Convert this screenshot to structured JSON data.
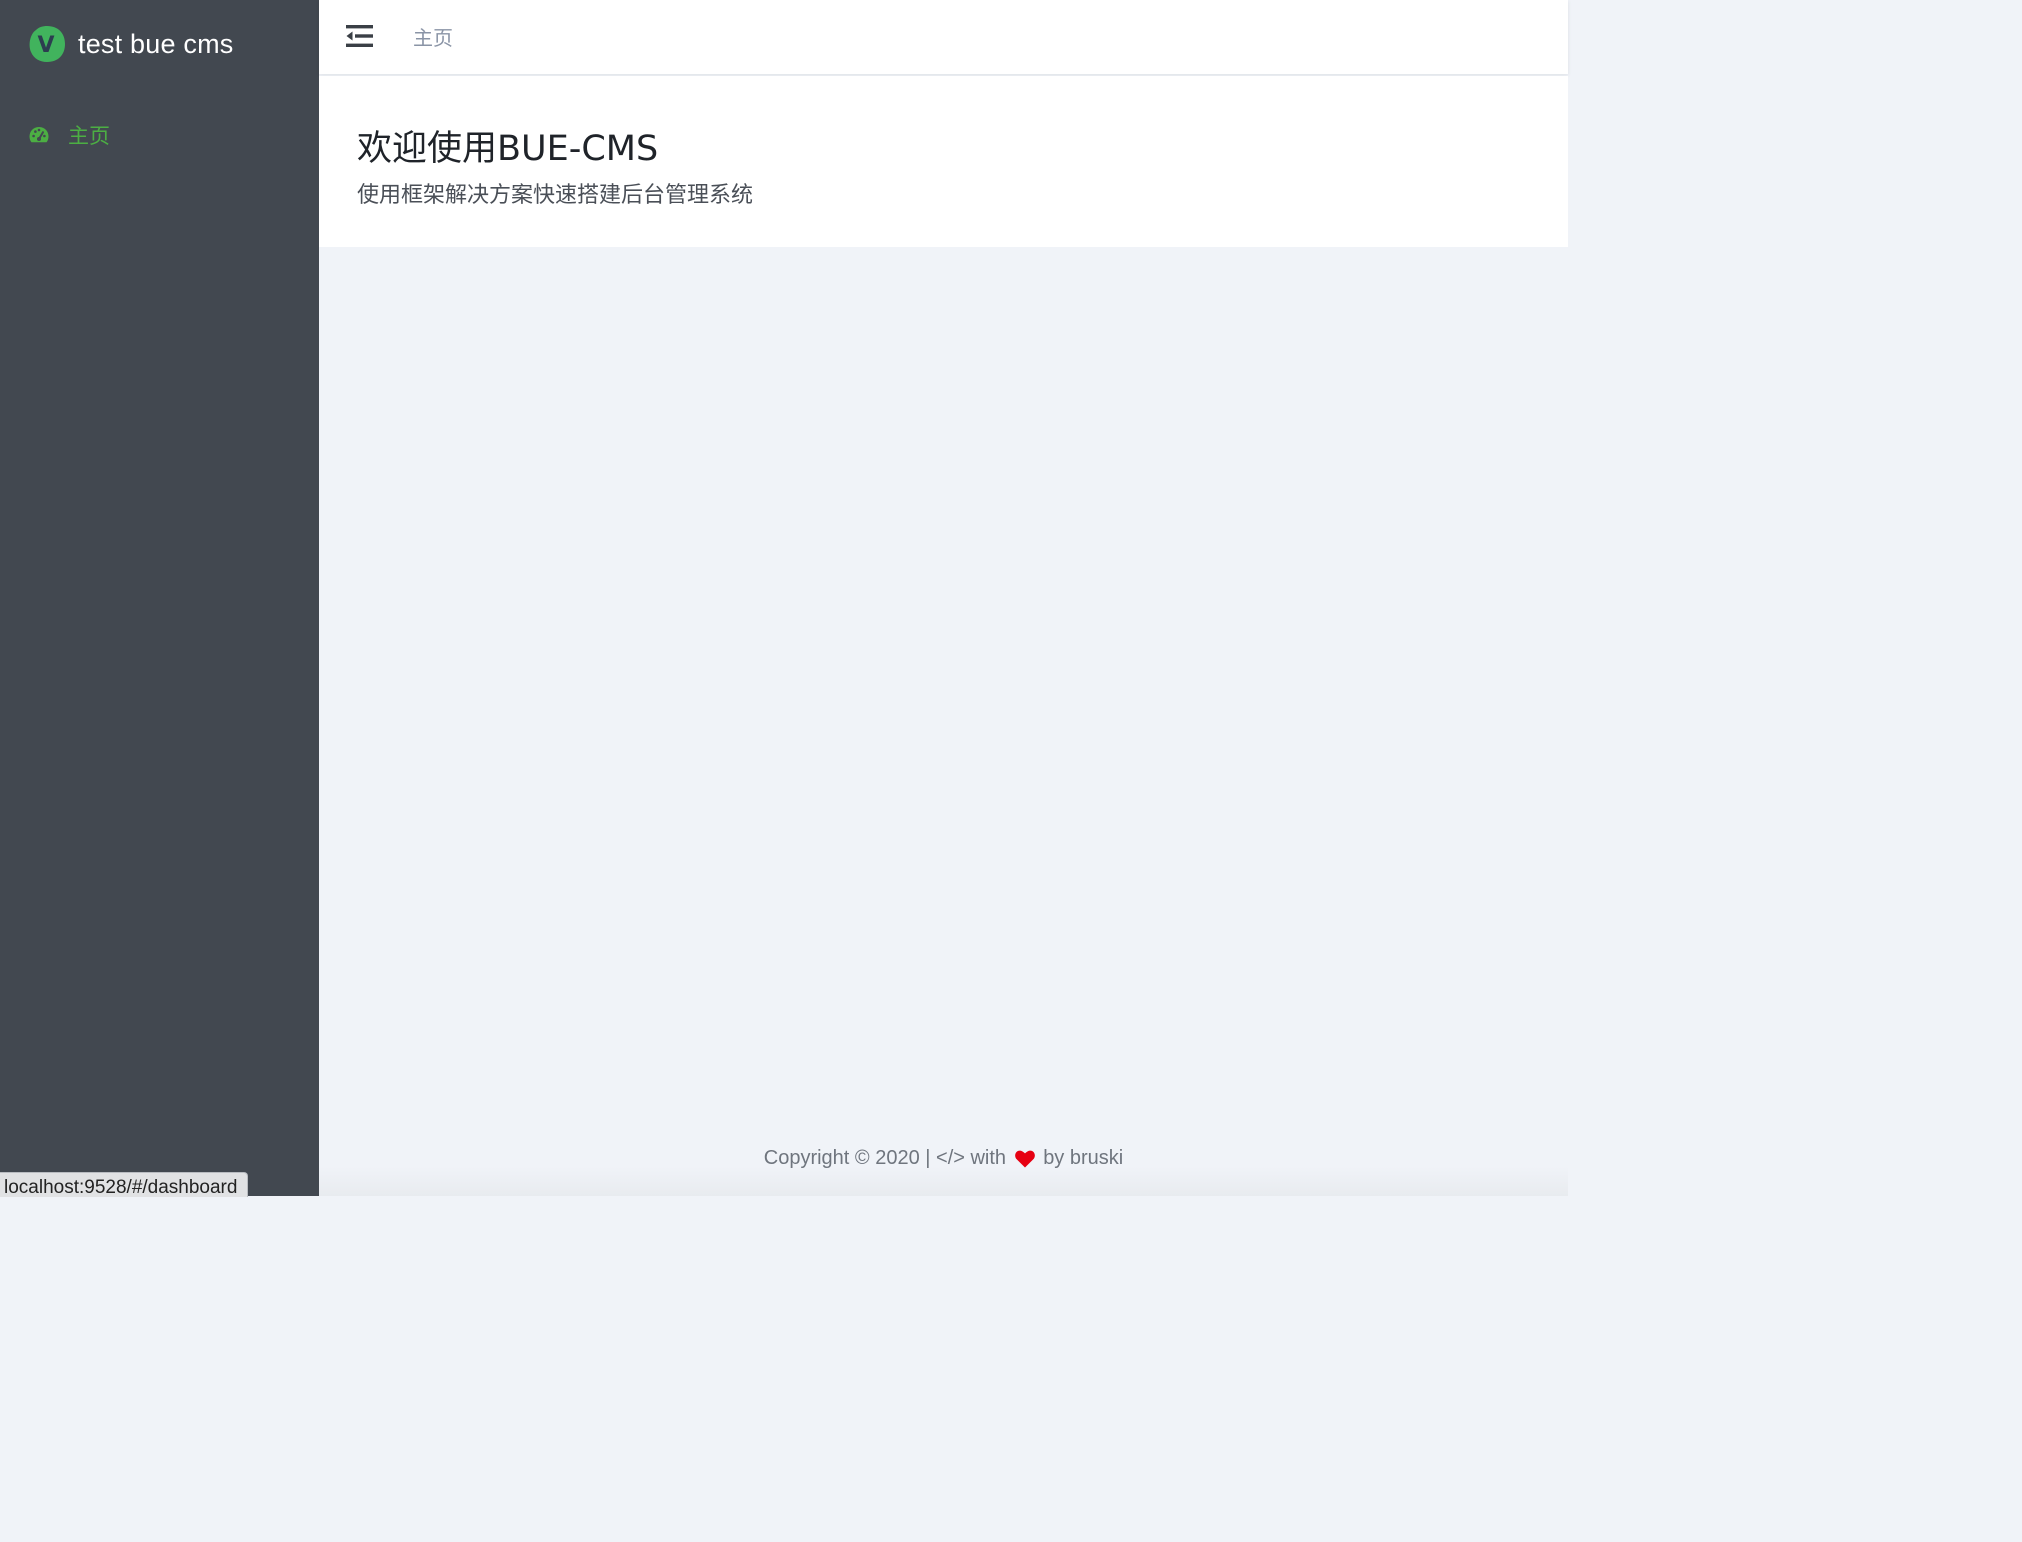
{
  "sidebar": {
    "logo_letter": "V",
    "app_title": "test bue cms",
    "items": [
      {
        "label": "主页",
        "icon": "dashboard-icon",
        "active": true
      }
    ],
    "background": "#424850",
    "active_color": "#4caf43"
  },
  "topbar": {
    "toggle_icon": "menu-fold-icon",
    "breadcrumb": "主页"
  },
  "welcome": {
    "title": "欢迎使用BUE-CMS",
    "subtitle": "使用框架解决方案快速搭建后台管理系统"
  },
  "footer": {
    "before": "Copyright © 2020 | </> with",
    "after": "by bruski",
    "heart_icon": "heart-icon",
    "heart_color": "#e60012"
  },
  "status_bar": {
    "url": "localhost:9528/#/dashboard"
  }
}
